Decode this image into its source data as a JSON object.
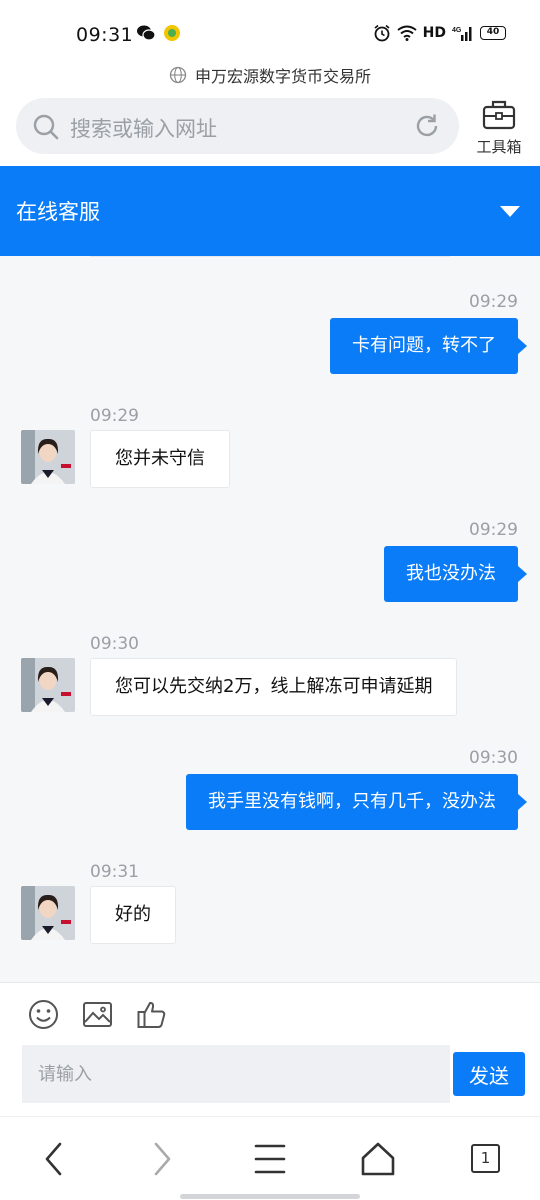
{
  "status_bar": {
    "time": "09:31",
    "network": "HD",
    "signal": "4G",
    "battery": "40"
  },
  "browser": {
    "site_title": "申万宏源数字货币交易所",
    "search_placeholder": "搜索或输入网址",
    "toolbox_label": "工具箱"
  },
  "chat": {
    "title": "在线客服",
    "messages": [
      {
        "time": "09:29",
        "direction": "out",
        "text": "卡有问题，转不了"
      },
      {
        "time": "09:29",
        "direction": "in",
        "text": "您并未守信"
      },
      {
        "time": "09:29",
        "direction": "out",
        "text": "我也没办法"
      },
      {
        "time": "09:30",
        "direction": "in",
        "text": "您可以先交纳2万，线上解冻可申请延期"
      },
      {
        "time": "09:30",
        "direction": "out",
        "text": "我手里没有钱啊，只有几千，没办法"
      },
      {
        "time": "09:31",
        "direction": "in",
        "text": "好的"
      }
    ]
  },
  "composer": {
    "placeholder": "请输入",
    "send_label": "发送",
    "tools": [
      "emoji-icon",
      "image-icon",
      "thumbs-up-icon"
    ]
  },
  "bottom_nav": {
    "tab_count": "1",
    "icons": [
      "back-icon",
      "forward-icon",
      "menu-icon",
      "home-icon",
      "tabs-icon"
    ]
  },
  "colors": {
    "accent": "#0a7cf8",
    "background": "#f6f7f9"
  }
}
